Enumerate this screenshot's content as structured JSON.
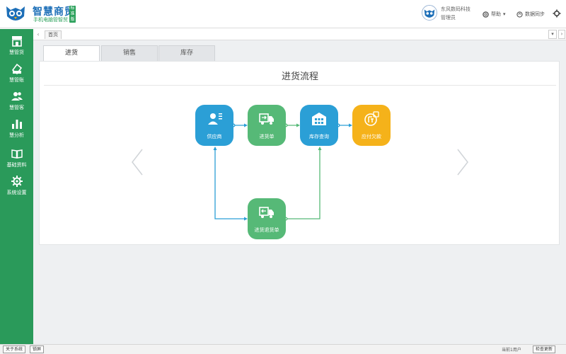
{
  "app": {
    "title": "智慧商贸",
    "subtitle": "手机电脑管智贸",
    "badge": "标准版"
  },
  "header": {
    "company_name": "东风数码科技",
    "user_role": "管理员",
    "help_label": "帮助",
    "sync_label": "数据同步"
  },
  "sidebar": {
    "items": [
      {
        "label": "慧管货",
        "icon": "store-icon"
      },
      {
        "label": "慧管账",
        "icon": "ledger-icon"
      },
      {
        "label": "慧管客",
        "icon": "users-icon"
      },
      {
        "label": "慧分析",
        "icon": "bar-chart-icon"
      },
      {
        "label": "基础资料",
        "icon": "book-icon"
      },
      {
        "label": "系统设置",
        "icon": "gear-icon"
      }
    ]
  },
  "tabs": {
    "home_label": "首页"
  },
  "subtabs": [
    {
      "label": "进货"
    },
    {
      "label": "销售"
    },
    {
      "label": "库存"
    }
  ],
  "panel": {
    "title": "进货流程"
  },
  "flow": {
    "nodes": [
      {
        "label": "供应商",
        "color": "#2b9fd6",
        "icon": "supplier-icon"
      },
      {
        "label": "进货单",
        "color": "#56b977",
        "icon": "truck-icon"
      },
      {
        "label": "库存查询",
        "color": "#2b9fd6",
        "icon": "warehouse-icon"
      },
      {
        "label": "应付欠款",
        "color": "#f5b21a",
        "icon": "payment-icon"
      },
      {
        "label": "进货退货单",
        "color": "#56b977",
        "icon": "return-truck-icon"
      }
    ]
  },
  "footer": {
    "about_label": "关于系统",
    "lock_label": "锁屏",
    "status_text": "当前1用户",
    "update_label": "检查更新"
  },
  "colors": {
    "sidebar": "#2a9a5a",
    "brand_blue": "#1d6fb8",
    "content_bg": "#eef0f2"
  }
}
